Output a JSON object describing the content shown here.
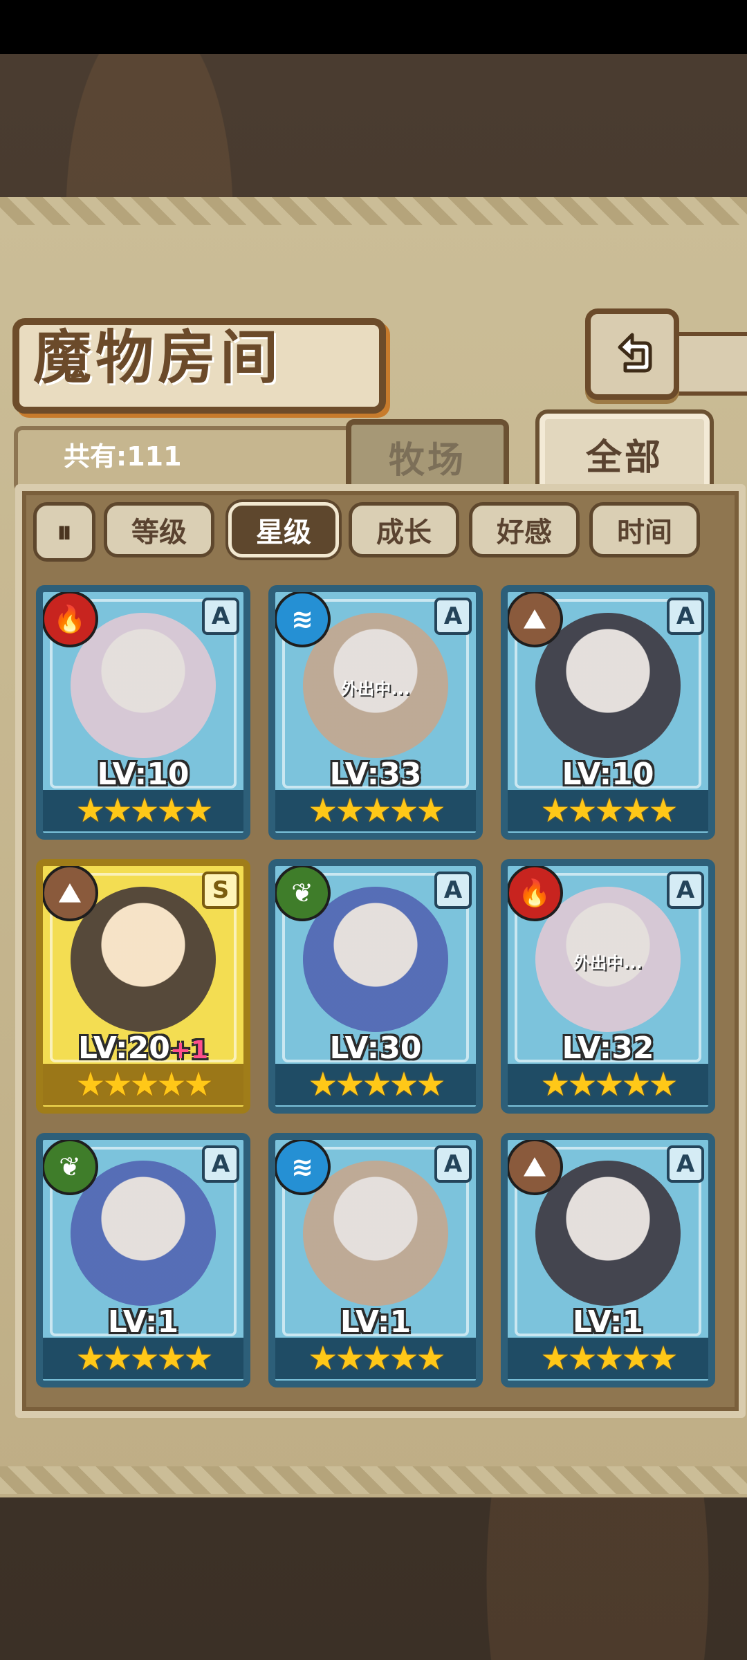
{
  "title": "魔物房间",
  "count": {
    "label": "共有:111"
  },
  "tabs": [
    {
      "label": "牧场",
      "active": false
    },
    {
      "label": "全部",
      "active": true
    }
  ],
  "sort": {
    "toggle_icon": "⏸",
    "buttons": [
      {
        "label": "等级",
        "active": false
      },
      {
        "label": "星级",
        "active": true
      },
      {
        "label": "成长",
        "active": false
      },
      {
        "label": "好感",
        "active": false
      },
      {
        "label": "时间",
        "active": false
      }
    ]
  },
  "element_glyphs": {
    "fire": "🔥",
    "water": "≋",
    "earth": "⛰",
    "leaf": "❦"
  },
  "cards": [
    {
      "level": "LV:10",
      "plus": "",
      "rank": "A",
      "element": "fire",
      "stars": "★★★★★",
      "out": ""
    },
    {
      "level": "LV:33",
      "plus": "",
      "rank": "A",
      "element": "water",
      "stars": "★★★★★",
      "out": "外出中..."
    },
    {
      "level": "LV:10",
      "plus": "",
      "rank": "A",
      "element": "earth",
      "stars": "★★★★★",
      "out": ""
    },
    {
      "level": "LV:20",
      "plus": "+1",
      "rank": "S",
      "element": "earth",
      "stars": "★★★★★",
      "out": ""
    },
    {
      "level": "LV:30",
      "plus": "",
      "rank": "A",
      "element": "leaf",
      "stars": "★★★★★",
      "out": ""
    },
    {
      "level": "LV:32",
      "plus": "",
      "rank": "A",
      "element": "fire",
      "stars": "★★★★★",
      "out": "外出中..."
    },
    {
      "level": "LV:1",
      "plus": "",
      "rank": "A",
      "element": "leaf",
      "stars": "★★★★★",
      "out": ""
    },
    {
      "level": "LV:1",
      "plus": "",
      "rank": "A",
      "element": "water",
      "stars": "★★★★★",
      "out": ""
    },
    {
      "level": "LV:1",
      "plus": "",
      "rank": "A",
      "element": "earth",
      "stars": "★★★★★",
      "out": ""
    }
  ]
}
